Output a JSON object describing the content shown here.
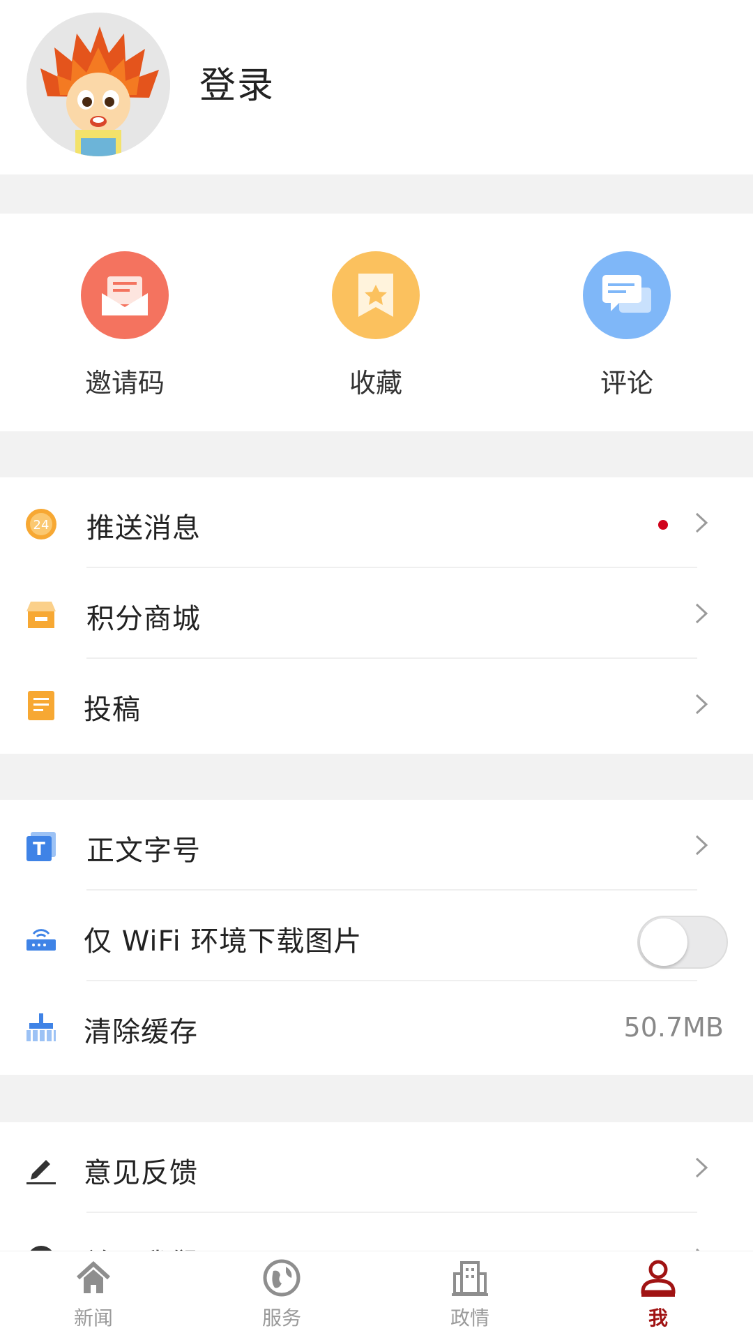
{
  "header": {
    "login_label": "登录",
    "avatar_icon": "mascot-avatar-icon"
  },
  "quick_actions": [
    {
      "label": "邀请码",
      "icon": "envelope-icon",
      "color": "#f4735f"
    },
    {
      "label": "收藏",
      "icon": "bookmark-icon",
      "color": "#fbc15e"
    },
    {
      "label": "评论",
      "icon": "comment-icon",
      "color": "#7fb7f8"
    }
  ],
  "section1": [
    {
      "label": "推送消息",
      "icon": "push-24-icon",
      "has_badge": true
    },
    {
      "label": "积分商城",
      "icon": "store-icon"
    },
    {
      "label": "投稿",
      "icon": "document-icon"
    }
  ],
  "section2": [
    {
      "label": "正文字号",
      "icon": "font-size-icon"
    },
    {
      "label": "仅 WiFi 环境下载图片",
      "icon": "router-icon",
      "toggle_on": false
    },
    {
      "label": "清除缓存",
      "icon": "broom-icon",
      "value": "50.7MB"
    }
  ],
  "section3": [
    {
      "label": "意见反馈",
      "icon": "pencil-icon"
    },
    {
      "label": "关于我们",
      "icon": "info-icon"
    }
  ],
  "bottom_nav": [
    {
      "label": "新闻",
      "icon": "home-icon",
      "active": false
    },
    {
      "label": "服务",
      "icon": "globe-icon",
      "active": false
    },
    {
      "label": "政情",
      "icon": "building-icon",
      "active": false
    },
    {
      "label": "我",
      "icon": "user-icon",
      "active": true
    }
  ],
  "colors": {
    "accent": "#a01313",
    "badge": "#d0021b",
    "gap": "#f2f2f2"
  }
}
